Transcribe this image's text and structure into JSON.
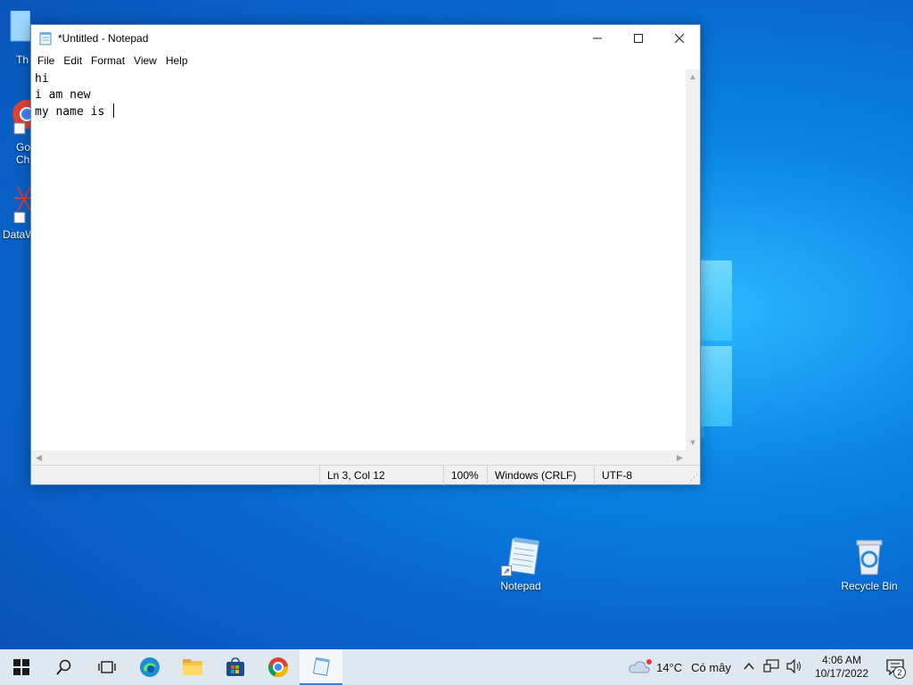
{
  "window": {
    "title": "*Untitled - Notepad",
    "menu": [
      "File",
      "Edit",
      "Format",
      "View",
      "Help"
    ],
    "content_lines": [
      "hi",
      "i am new",
      "my name is "
    ],
    "status": {
      "position": "Ln 3, Col 12",
      "zoom": "100%",
      "line_ending": "Windows (CRLF)",
      "encoding": "UTF-8"
    }
  },
  "desktop": {
    "icons": [
      {
        "label": "Notepad",
        "icon": "notepad-icon"
      },
      {
        "label": "Recycle Bin",
        "icon": "recycle-bin-icon"
      }
    ],
    "partial_icons": [
      "Th",
      "Go",
      "Ch",
      "DataW"
    ]
  },
  "taskbar": {
    "weather": {
      "temp": "14°C",
      "condition": "Có mây"
    },
    "clock": {
      "time": "4:06 AM",
      "date": "10/17/2022"
    },
    "notifications": "2"
  },
  "colors": {
    "accent": "#3b7fd6",
    "taskbar_bg": "#dfe7ef",
    "desktop_bg": "#0a86e6"
  }
}
